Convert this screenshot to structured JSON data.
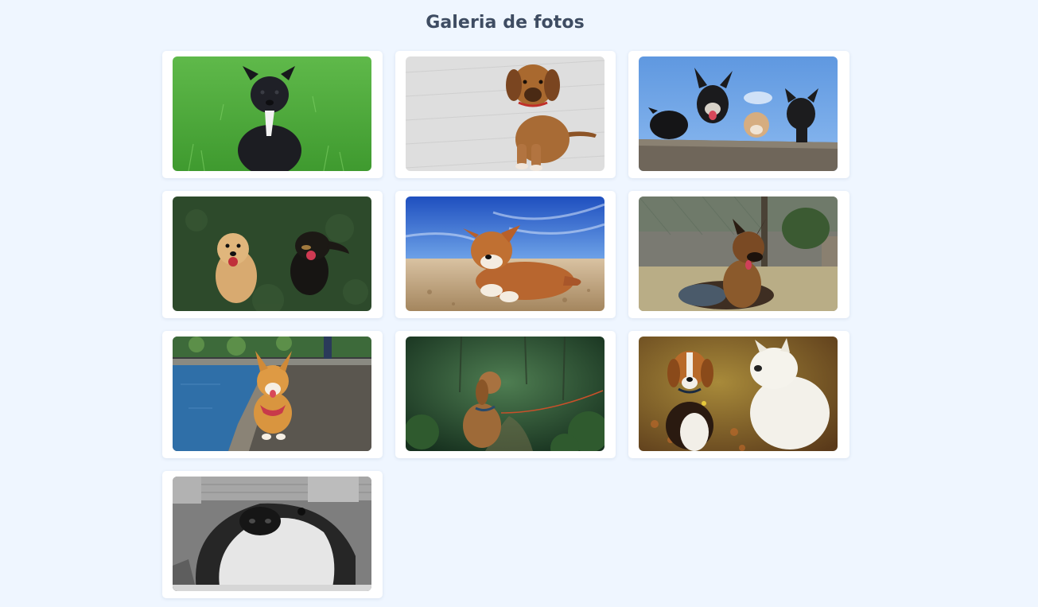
{
  "page": {
    "title": "Galeria de fotos"
  },
  "photos": [
    {
      "subject": "black-puppy-on-grass",
      "colors": {
        "background": "#4aa63a",
        "subject": "#1c1d22"
      }
    },
    {
      "subject": "brown-puppy-on-carpet",
      "colors": {
        "background": "#dcdcdc",
        "subject": "#a76a35"
      }
    },
    {
      "subject": "four-dogs-over-wall",
      "colors": {
        "background": "#74a9e8",
        "subject": "#1b1b1d"
      }
    },
    {
      "subject": "two-dogs-on-grass",
      "colors": {
        "background": "#2c4a2a",
        "subject": "#d8aa70"
      }
    },
    {
      "subject": "corgi-on-beach",
      "colors": {
        "background": "#2a63c8",
        "subject": "#b8662f"
      }
    },
    {
      "subject": "german-shepherd-lying",
      "colors": {
        "background": "#9a9a7e",
        "subject": "#6b4224"
      }
    },
    {
      "subject": "corgi-on-pier",
      "colors": {
        "background": "#2f6fa8",
        "subject": "#d9953f"
      }
    },
    {
      "subject": "spaniel-in-forest",
      "colors": {
        "background": "#1f4a2c",
        "subject": "#a26b3a"
      }
    },
    {
      "subject": "beagle-and-westie",
      "colors": {
        "background": "#8a6b2a",
        "subject": "#f3f1ea"
      }
    },
    {
      "subject": "dog-under-fence-grayscale",
      "colors": {
        "background": "#8c8c8c",
        "subject": "#2b2b2b"
      }
    }
  ]
}
